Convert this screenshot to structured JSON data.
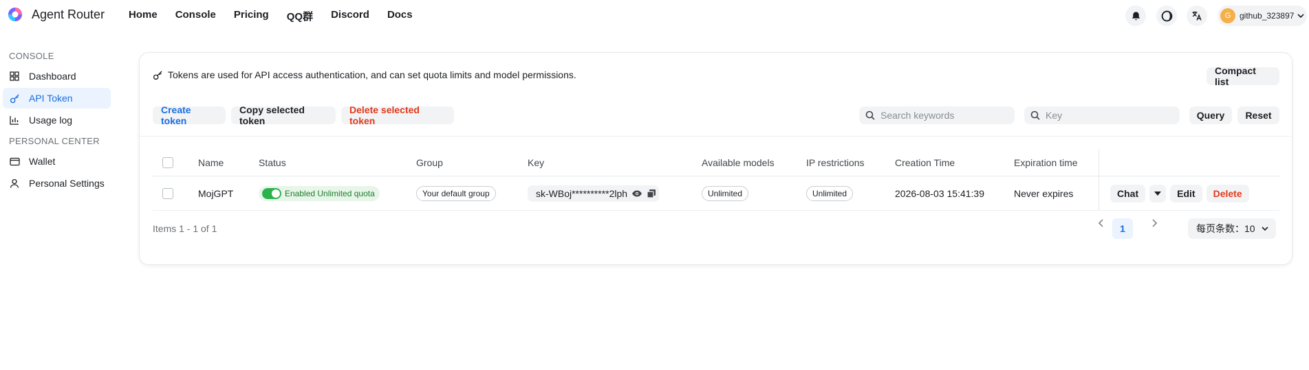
{
  "brand": {
    "name": "Agent Router"
  },
  "nav": [
    "Home",
    "Console",
    "Pricing",
    "QQ群",
    "Discord",
    "Docs"
  ],
  "user": {
    "avatar_letter": "G",
    "name": "github_323897"
  },
  "sidebar": {
    "sections": [
      {
        "title": "CONSOLE",
        "items": [
          {
            "label": "Dashboard",
            "icon": "dashboard-icon"
          },
          {
            "label": "API Token",
            "icon": "key-icon",
            "active": true
          },
          {
            "label": "Usage log",
            "icon": "bar-chart-icon"
          }
        ]
      },
      {
        "title": "PERSONAL CENTER",
        "items": [
          {
            "label": "Wallet",
            "icon": "wallet-icon"
          },
          {
            "label": "Personal Settings",
            "icon": "user-icon"
          }
        ]
      }
    ]
  },
  "notice": "Tokens are used for API access authentication, and can set quota limits and model permissions.",
  "toolbar": {
    "compact_list": "Compact list",
    "create_token": "Create token",
    "copy_selected": "Copy selected token",
    "delete_selected": "Delete selected token",
    "search_placeholder": "Search keywords",
    "key_placeholder": "Key",
    "query": "Query",
    "reset": "Reset"
  },
  "table": {
    "columns": [
      "Name",
      "Status",
      "Group",
      "Key",
      "Available models",
      "IP restrictions",
      "Creation Time",
      "Expiration time"
    ],
    "rows": [
      {
        "name": "MojGPT",
        "status": "Enabled Unlimited quota",
        "group": "Your default group",
        "key": "sk-WBoj**********2lph",
        "models": "Unlimited",
        "ip": "Unlimited",
        "created": "2026-08-03 15:41:39",
        "expires": "Never expires",
        "actions": {
          "chat": "Chat",
          "edit": "Edit",
          "delete": "Delete"
        }
      }
    ]
  },
  "footer": {
    "items_count": "Items 1 - 1 of 1",
    "current_page": "1",
    "page_size_label": "每页条数：10"
  },
  "colors": {
    "accent": "#1b6ee0",
    "danger": "#e0391b",
    "success": "#2bb24c"
  }
}
